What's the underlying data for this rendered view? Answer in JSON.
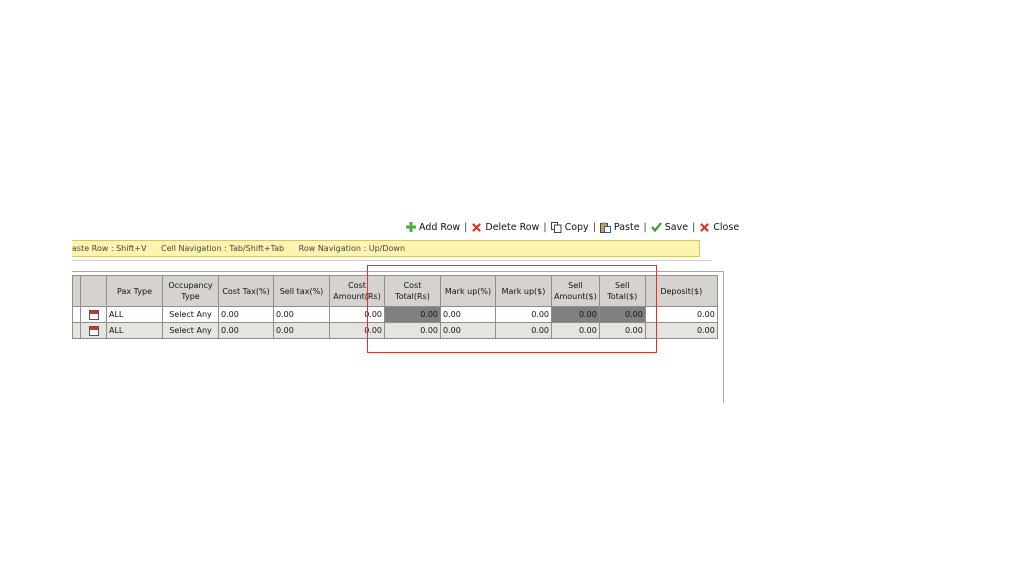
{
  "toolbar": {
    "add_row": "Add Row",
    "delete_row": "Delete Row",
    "copy": "Copy",
    "paste": "Paste",
    "save": "Save",
    "close": "Close",
    "separator": "|",
    "icons": {
      "add_row": "plus-icon",
      "delete_row": "delete-icon",
      "copy": "copy-icon",
      "paste": "paste-icon",
      "save": "check-icon",
      "close": "close-icon"
    }
  },
  "hints": {
    "paste": "aste Row : Shift+V",
    "cell_nav": "Cell Navigation : Tab/Shift+Tab",
    "row_nav": "Row Navigation : Up/Down"
  },
  "grid": {
    "headers": {
      "blank1": "",
      "blank2": "",
      "pax_type": "Pax Type",
      "occupancy_type_1": "Occupancy",
      "occupancy_type_2": "Type",
      "cost_tax": "Cost Tax(%)",
      "sell_tax": "Sell tax(%)",
      "cost_amount_1": "Cost",
      "cost_amount_2": "Amount(Rs)",
      "cost_total_1": "Cost",
      "cost_total_2": "Total(Rs)",
      "markup_pct": "Mark up(%)",
      "markup_usd": "Mark up($)",
      "sell_amount_1": "Sell",
      "sell_amount_2": "Amount($)",
      "sell_total_1": "Sell",
      "sell_total_2": "Total($)",
      "deposit": "Deposit($)"
    },
    "rows": [
      {
        "pax_type": "ALL",
        "occupancy_type": "Select Any",
        "cost_tax": "0.00",
        "sell_tax": "0.00",
        "cost_amount": "0.00",
        "cost_total": "0.00",
        "markup_pct": "0.00",
        "markup_usd": "0.00",
        "sell_amount": "0.00",
        "sell_total": "0.00",
        "deposit": "0.00"
      },
      {
        "pax_type": "ALL",
        "occupancy_type": "Select Any",
        "cost_tax": "0.00",
        "sell_tax": "0.00",
        "cost_amount": "0.00",
        "cost_total": "0.00",
        "markup_pct": "0.00",
        "markup_usd": "0.00",
        "sell_amount": "0.00",
        "sell_total": "0.00",
        "deposit": "0.00"
      }
    ]
  },
  "colors": {
    "highlight": "#e4312b",
    "hint_bg": "#fdf4b1",
    "header_bg": "#d6d3ce",
    "readonly_cell": "#808080"
  }
}
